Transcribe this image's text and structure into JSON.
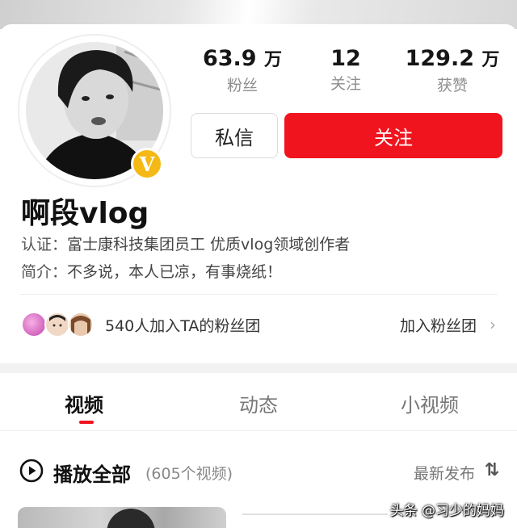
{
  "profile": {
    "name": "啊段vlog",
    "verified_badge": "V",
    "certification_key": "认证：",
    "certification_value": "富士康科技集团员工 优质vlog领域创作者",
    "bio_key": "简介：",
    "bio_value": "不多说，本人已凉，有事烧纸！"
  },
  "stats": {
    "fans": {
      "value": "63.9",
      "unit": "万",
      "label": "粉丝"
    },
    "following": {
      "value": "12",
      "unit": "",
      "label": "关注"
    },
    "likes": {
      "value": "129.2",
      "unit": "万",
      "label": "获赞"
    }
  },
  "actions": {
    "message_label": "私信",
    "follow_label": "关注"
  },
  "fan_club": {
    "text": "540人加入TA的粉丝团",
    "join_label": "加入粉丝团",
    "chevron": "›"
  },
  "tabs": [
    {
      "label": "视频",
      "active": true
    },
    {
      "label": "动态",
      "active": false
    },
    {
      "label": "小视频",
      "active": false
    }
  ],
  "video_list": {
    "play_all_label": "播放全部",
    "count_text": "(605个视频)",
    "sort_label": "最新发布",
    "sort_icon": "⇅"
  },
  "watermark": "头条 @习少的妈妈",
  "colors": {
    "accent": "#f0141e",
    "verified": "#f4b915",
    "muted_text": "#8e8e8e"
  },
  "icons": [
    "verified-v-icon",
    "play-circle-icon",
    "chevron-right-icon",
    "sort-icon"
  ]
}
